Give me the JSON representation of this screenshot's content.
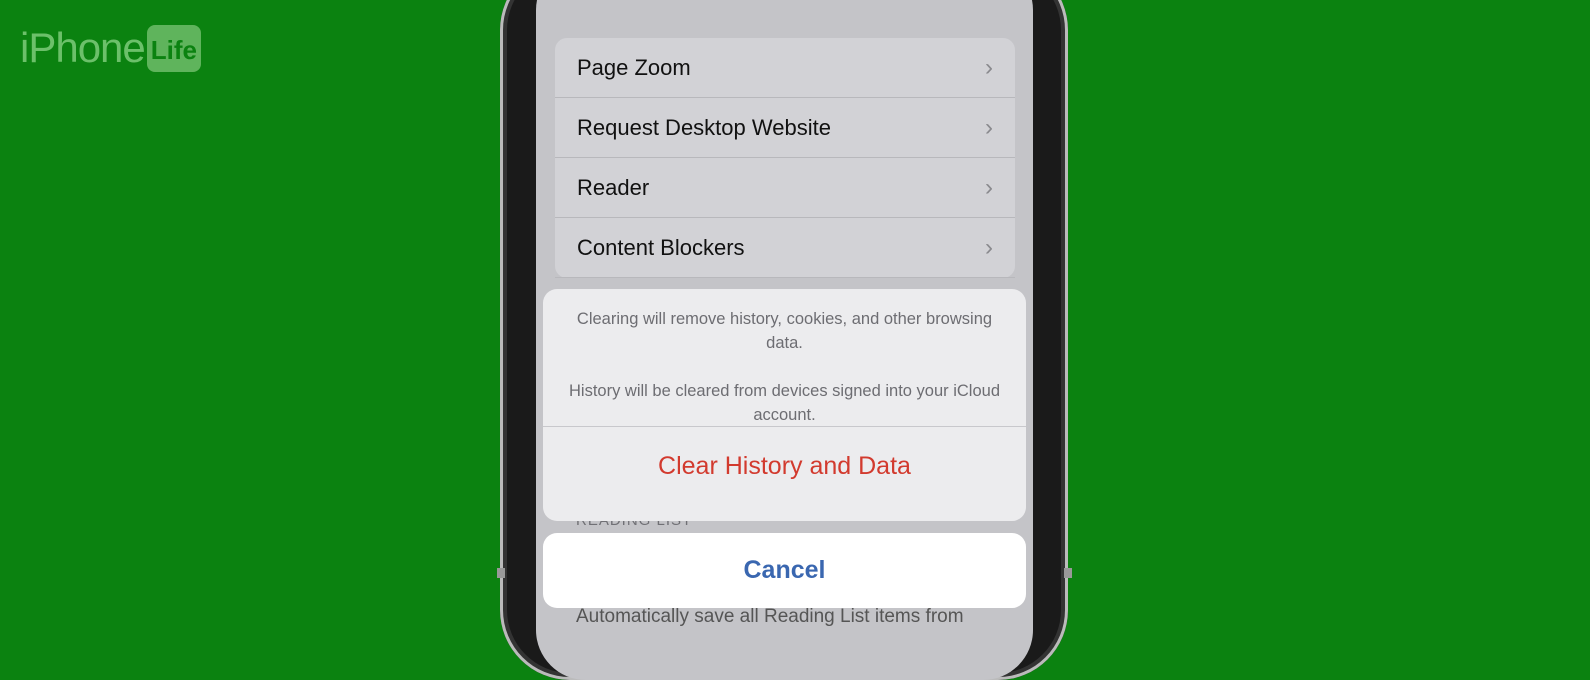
{
  "logo": {
    "text_a": "iPhone",
    "text_b": "Life"
  },
  "settings": {
    "rows": [
      {
        "label": "Page Zoom"
      },
      {
        "label": "Request Desktop Website"
      },
      {
        "label": "Reader"
      },
      {
        "label": "Content Blockers"
      }
    ],
    "reading_list_header": "READING LIST",
    "reading_list_footer": "Automatically save all Reading List items from"
  },
  "sheet": {
    "message1": "Clearing will remove history, cookies, and other browsing data.",
    "message2": "History will be cleared from devices signed into your iCloud account.",
    "destructive_label": "Clear History and Data",
    "cancel_label": "Cancel"
  },
  "colors": {
    "background": "#0b8210",
    "destructive": "#d23a2e",
    "cancel": "#3a67b0"
  }
}
